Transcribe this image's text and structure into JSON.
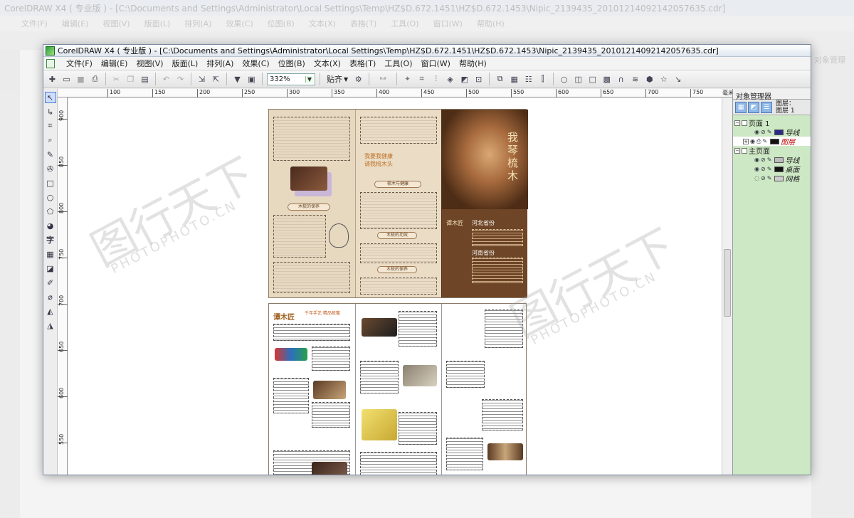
{
  "background_window": {
    "title": "CorelDRAW X4 ( 专业版 ) - [C:\\Documents and Settings\\Administrator\\Local Settings\\Temp\\HZ$D.672.1451\\HZ$D.672.1453\\Nipic_2139435_20101214092142057635.cdr]",
    "menu": [
      "文件(F)",
      "编辑(E)",
      "视图(V)",
      "版面(L)",
      "排列(A)",
      "效果(C)",
      "位图(B)",
      "文本(X)",
      "表格(T)",
      "工具(O)",
      "窗口(W)",
      "帮助(H)"
    ],
    "docker_label": "对象管理"
  },
  "window": {
    "title": "CorelDRAW X4 ( 专业版 ) - [C:\\Documents and Settings\\Administrator\\Local Settings\\Temp\\HZ$D.672.1451\\HZ$D.672.1453\\Nipic_2139435_20101214092142057635.cdr]",
    "menu": [
      "文件(F)",
      "编辑(E)",
      "视图(V)",
      "版面(L)",
      "排列(A)",
      "效果(C)",
      "位图(B)",
      "文本(X)",
      "表格(T)",
      "工具(O)",
      "窗口(W)",
      "帮助(H)"
    ],
    "zoom_value": "332%",
    "snap_label": "贴齐"
  },
  "ruler": {
    "h_ticks": [
      "100",
      "150",
      "200",
      "250",
      "300",
      "350",
      "400",
      "450",
      "500",
      "550",
      "600",
      "650",
      "700",
      "750"
    ],
    "unit": "毫米",
    "v_ticks": [
      "900",
      "850",
      "800",
      "750",
      "700",
      "650",
      "600",
      "550"
    ]
  },
  "docker": {
    "title": "对象管理器",
    "layer_label_1": "图层：",
    "layer_label_2": "图层 1",
    "tree": [
      {
        "name": "页面 1",
        "level": 0
      },
      {
        "name": "导线",
        "level": 1
      },
      {
        "name": "图层",
        "level": 1,
        "color": "#c00000"
      },
      {
        "name": "主页面",
        "level": 0
      },
      {
        "name": "导线",
        "level": 1
      },
      {
        "name": "桌面",
        "level": 1
      },
      {
        "name": "网格",
        "level": 1
      }
    ]
  },
  "brochure": {
    "cover_title": "我琴梳木",
    "section_titles": [
      "梳木与健康",
      "木梳的保养",
      "木梳的功效"
    ],
    "slogan_1": "我要我健康",
    "slogan_2": "请我梳木头",
    "contact_1": "河北省份",
    "contact_2": "河南省份",
    "brand": "谭木匠",
    "brand_sub": "千年手艺·精品梳篦"
  },
  "watermark": {
    "main": "图行天下",
    "sub": "PHOTOPHOTO.CN"
  }
}
